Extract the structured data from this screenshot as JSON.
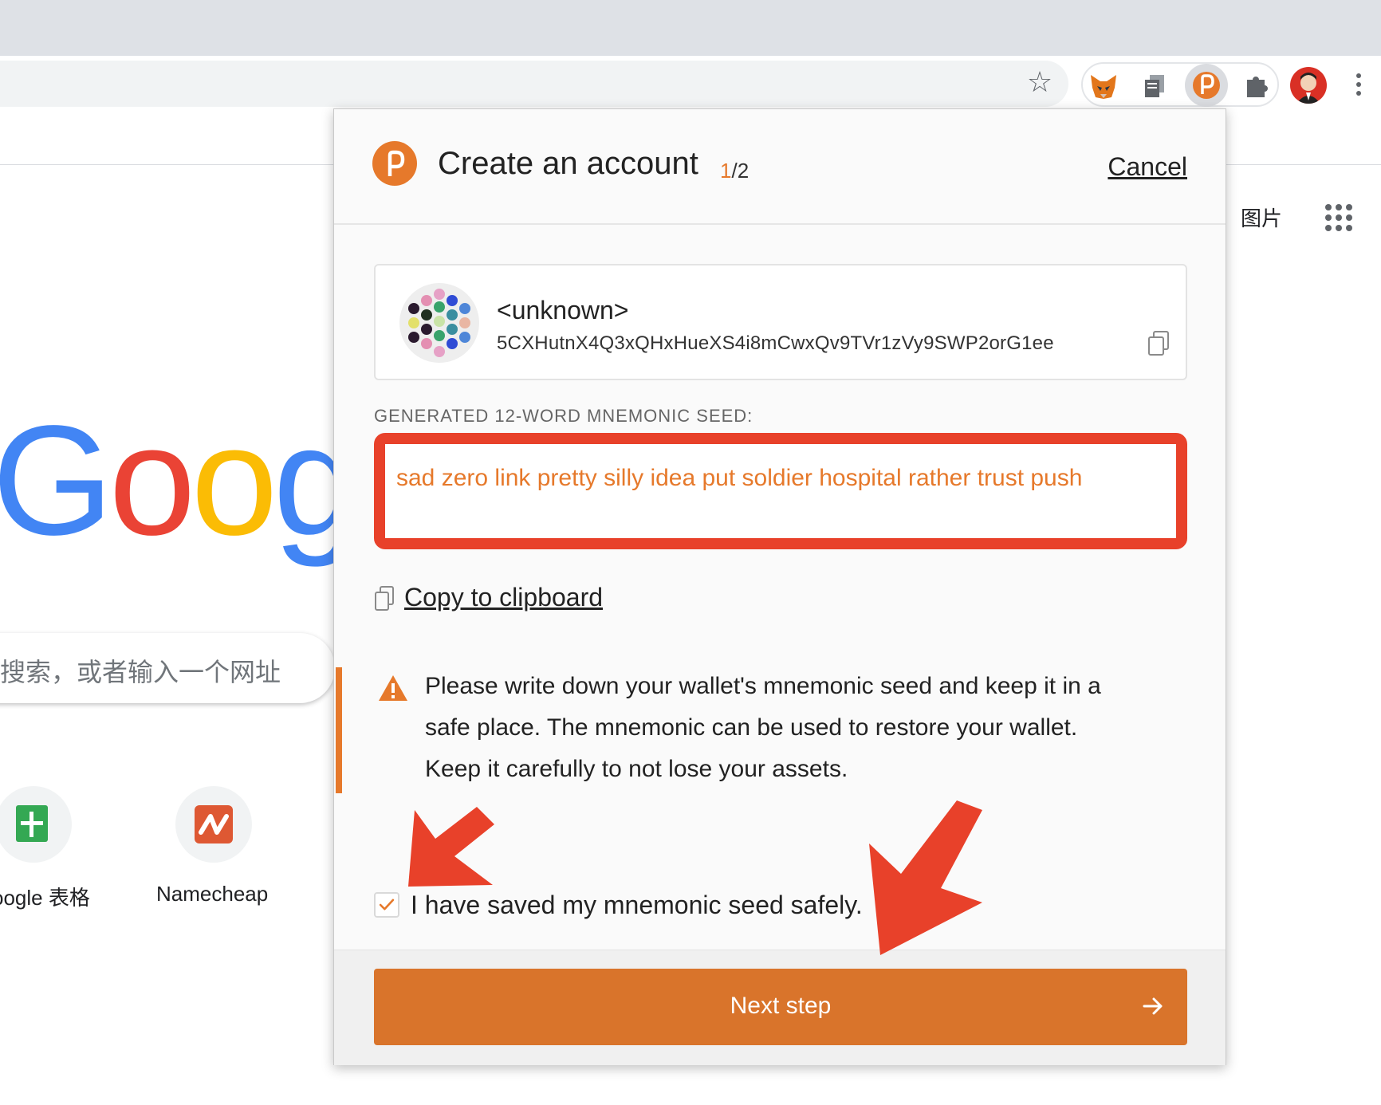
{
  "browser": {
    "extensions": [
      "metamask-fox-icon",
      "copy-icon",
      "polkadot-icon",
      "puzzle-icon"
    ]
  },
  "google_page": {
    "images_link": "图片",
    "logo_text": "Goog",
    "search_placeholder": "搜索，或者输入一个网址",
    "shortcuts": [
      {
        "label": "oogle 表格",
        "icon": "google-sheets-icon"
      },
      {
        "label": "Namecheap",
        "icon": "namecheap-icon"
      }
    ]
  },
  "popup": {
    "title": "Create an account",
    "step_current": "1",
    "step_total": "/2",
    "cancel_label": "Cancel",
    "account": {
      "name": "<unknown>",
      "address": "5CXHutnX4Q3xQHxHueXS4i8mCwxQv9TVr1zVy9SWP2orG1ee"
    },
    "seed_label": "GENERATED 12-WORD MNEMONIC SEED:",
    "seed_phrase": "sad zero link pretty silly idea put soldier hospital rather trust push",
    "copy_label": "Copy to clipboard",
    "warning": "Please write down your wallet's mnemonic seed and keep it in a safe place. The mnemonic can be used to restore your wallet. Keep it carefully to not lose your assets.",
    "checkbox_label": "I have saved my mnemonic seed safely.",
    "checkbox_checked": true,
    "next_label": "Next step"
  },
  "colors": {
    "accent": "#e6792b",
    "button": "#d9742b",
    "highlight": "#e8412a"
  }
}
